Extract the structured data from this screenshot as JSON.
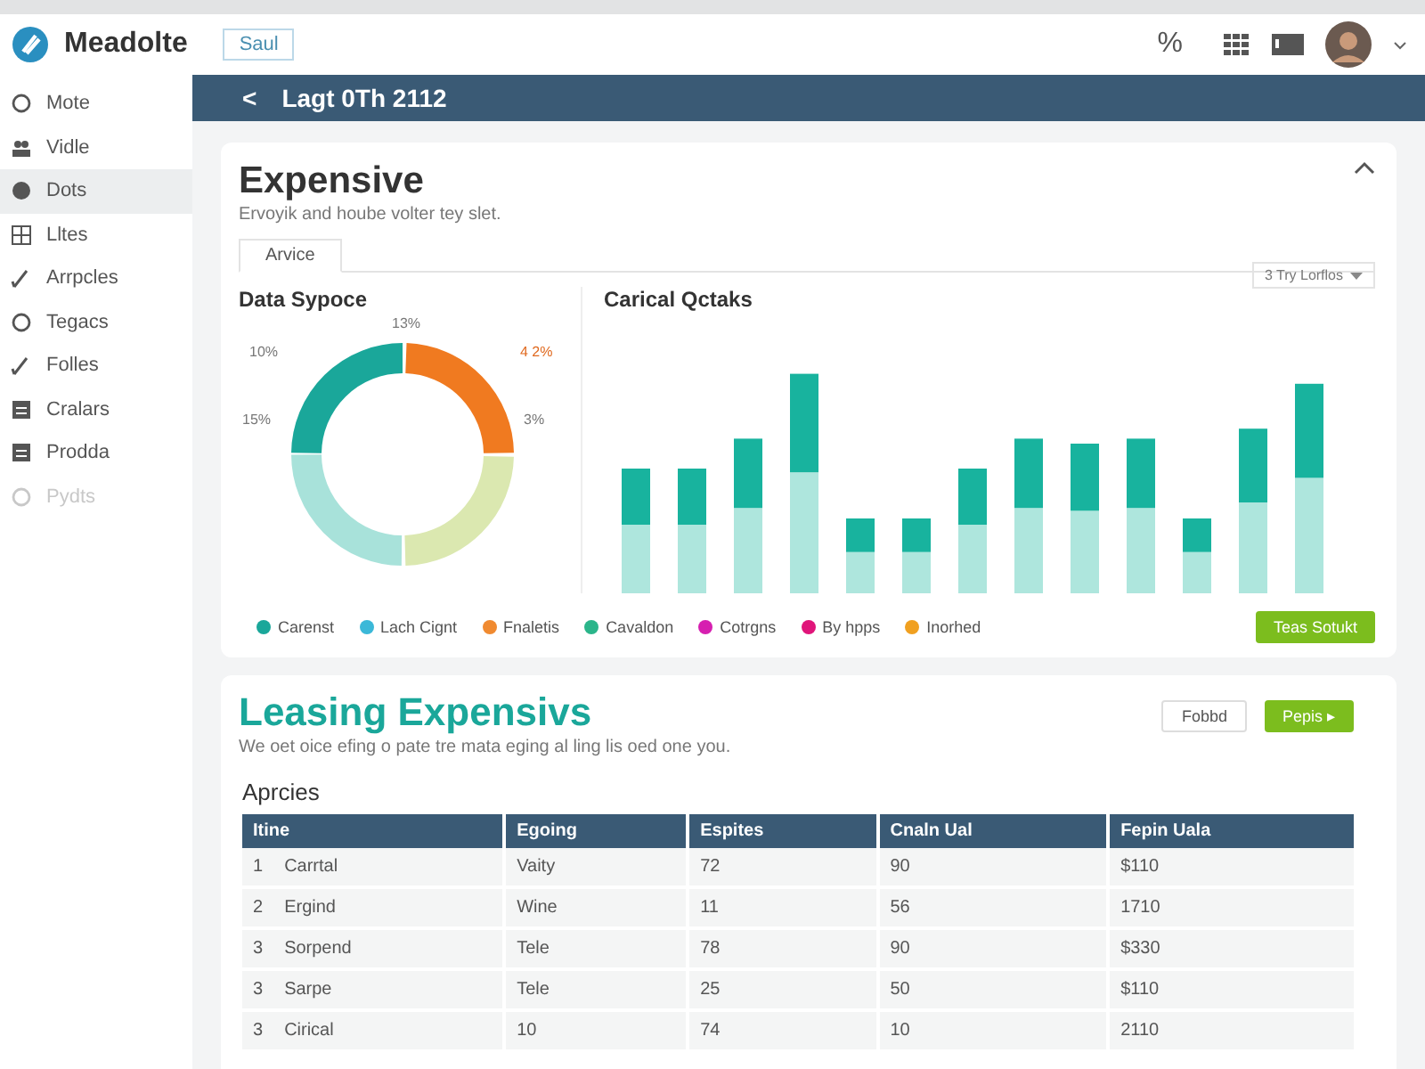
{
  "topbar": {
    "brand": "Meadolte",
    "button": "Saul",
    "percent": "%"
  },
  "sidebar": {
    "items": [
      {
        "label": "Mote",
        "selected": false,
        "disabled": false
      },
      {
        "label": "Vidle",
        "selected": false,
        "disabled": false
      },
      {
        "label": "Dots",
        "selected": true,
        "disabled": false
      },
      {
        "label": "Lltes",
        "selected": false,
        "disabled": false
      },
      {
        "label": "Arrpcles",
        "selected": false,
        "disabled": false
      },
      {
        "label": "Tegacs",
        "selected": false,
        "disabled": false
      },
      {
        "label": "Folles",
        "selected": false,
        "disabled": false
      },
      {
        "label": "Cralars",
        "selected": false,
        "disabled": false
      },
      {
        "label": "Prodda",
        "selected": false,
        "disabled": false
      },
      {
        "label": "Pydts",
        "selected": false,
        "disabled": true
      }
    ]
  },
  "header": {
    "back": "<",
    "title": "Lagt 0Th 2112"
  },
  "card": {
    "title": "Expensive",
    "subtitle": "Ervoyik and hoube volter tey slet.",
    "tabs": [
      {
        "label": "Arvice",
        "selected": true
      }
    ],
    "donut": {
      "title": "Data Sypoce",
      "labels": [
        "13%",
        "10%",
        "4 2%",
        "15%",
        "3%"
      ]
    },
    "bars": {
      "title": "Carical Qctaks",
      "dropdown": "3 Try Lorflos"
    },
    "legend": [
      {
        "label": "Carenst",
        "color": "#1aa79a"
      },
      {
        "label": "Lach Cignt",
        "color": "#3bb8d8"
      },
      {
        "label": "Fnaletis",
        "color": "#f08a30"
      },
      {
        "label": "Cavaldon",
        "color": "#2bb58a"
      },
      {
        "label": "Cotrgns",
        "color": "#d61fb0"
      },
      {
        "label": "By hpps",
        "color": "#e0157a"
      },
      {
        "label": "Inorhed",
        "color": "#f0a020"
      }
    ],
    "action": "Teas Sotukt"
  },
  "leasing": {
    "title": "Leasing Expensivs",
    "subtitle": "We oet oice efing o pate tre mata eging al ling lis oed one you.",
    "buttons": [
      {
        "label": "Fobbd",
        "kind": "plain"
      },
      {
        "label": "Pepis ▸",
        "kind": "primary"
      }
    ],
    "section": "Aprcies",
    "columns": [
      "Itine",
      "Egoing",
      "Espites",
      "Cnaln Ual",
      "Fepin Uala"
    ],
    "rows": [
      {
        "index": "1",
        "cells": [
          "Carrtal",
          "Vaity",
          "72",
          "90",
          "$110"
        ]
      },
      {
        "index": "2",
        "cells": [
          "Ergind",
          "Wine",
          "11",
          "56",
          "1710"
        ]
      },
      {
        "index": "3",
        "cells": [
          "Sorpend",
          "Tele",
          "78",
          "90",
          "$330"
        ]
      },
      {
        "index": "3",
        "cells": [
          "Sarpe",
          "Tele",
          "25",
          "50",
          "$110"
        ]
      },
      {
        "index": "3",
        "cells": [
          "Cirical",
          "10",
          "74",
          "10",
          "2110"
        ]
      }
    ]
  }
}
